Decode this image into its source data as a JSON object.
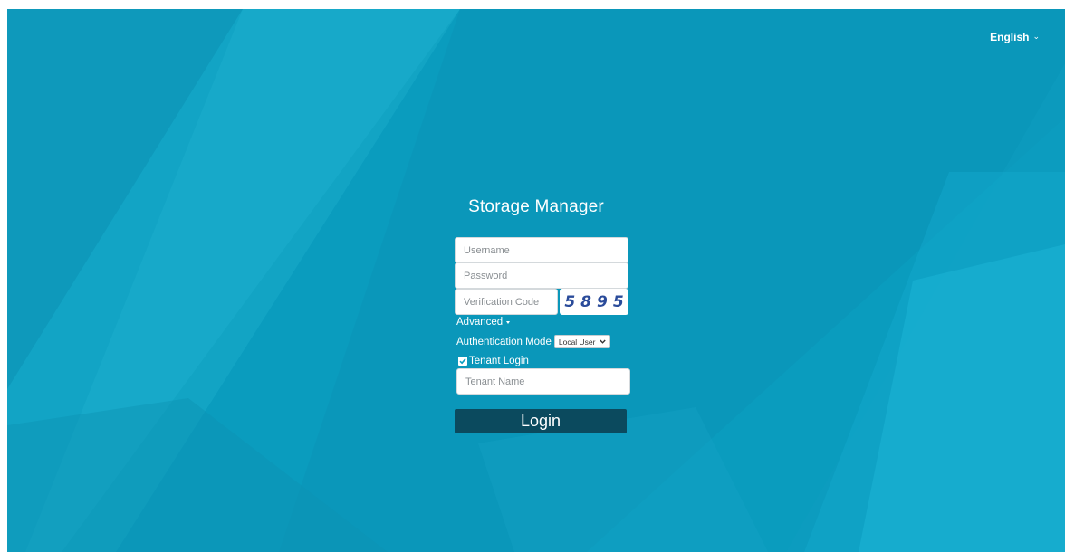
{
  "header": {
    "language_label": "English"
  },
  "login": {
    "title": "Storage Manager",
    "username_placeholder": "Username",
    "password_placeholder": "Password",
    "verification_placeholder": "Verification Code",
    "captcha_text": "5895",
    "advanced_label": "Advanced",
    "auth_mode_label": "Authentication Mode",
    "auth_mode_selected": "Local User",
    "tenant_login_label": "Tenant Login",
    "tenant_login_checked": true,
    "tenant_name_placeholder": "Tenant Name",
    "login_button_label": "Login"
  },
  "colors": {
    "background": "#0a9ec0",
    "button": "#0b4a5e",
    "captcha_text": "#2a4b9a"
  }
}
